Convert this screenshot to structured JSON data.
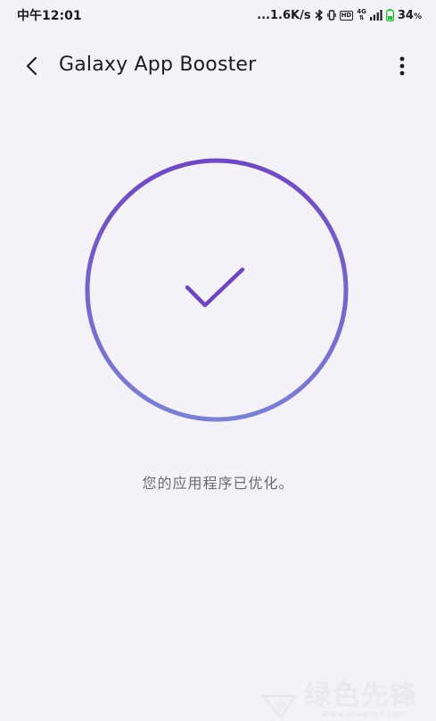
{
  "status_bar": {
    "time": "中午12:01",
    "network_speed": "...1.6K/s",
    "bluetooth_icon": "bluetooth-icon",
    "vibrate_icon": "vibrate-icon",
    "hd_label": "HD",
    "network_type": "4G",
    "signal_icon": "signal-bars-icon",
    "battery_icon": "battery-icon",
    "battery_level": "34",
    "battery_unit": "%"
  },
  "app_bar": {
    "title": "Galaxy App Booster",
    "back_icon": "back-arrow-icon",
    "more_icon": "more-vert-icon"
  },
  "result": {
    "status_icon": "checkmark-icon",
    "message": "您的应用程序已优化。"
  },
  "watermark": {
    "main": "绿色先锋",
    "sub": "www.greenxf.com"
  },
  "colors": {
    "background": "#f5f1f8",
    "ring_top": "#7048c2",
    "ring_bottom": "#7a7fd0",
    "check": "#6e44bf",
    "battery_fill": "#2fbf3f"
  }
}
